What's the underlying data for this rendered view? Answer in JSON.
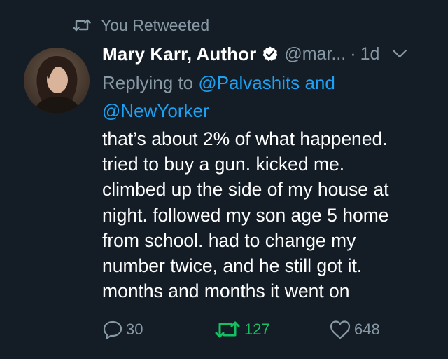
{
  "retweet_context": {
    "label": "You Retweeted",
    "icon": "retweet-icon"
  },
  "author": {
    "name": "Mary Karr, Author",
    "verified_icon": "verified-badge-icon",
    "handle": "@mar...",
    "separator": "·",
    "time": "1d",
    "menu_icon": "chevron-down-icon"
  },
  "reply": {
    "prefix": "Replying to ",
    "mention_1": "@Palvashits",
    "conjunction": " and",
    "mention_2": "@NewYorker"
  },
  "tweet": {
    "lines": [
      "that’s about 2% of what happened.",
      "tried to buy a gun. kicked me.",
      "climbed up the side of my house at",
      "night. followed my son age 5 home",
      "from school. had to change my",
      "number twice, and he still got it.",
      "months and months it went on"
    ]
  },
  "actions": {
    "reply_count": "30",
    "retweet_count": "127",
    "like_count": "648"
  },
  "colors": {
    "background": "#141d26",
    "text": "#ffffff",
    "muted": "#8899a6",
    "link": "#1da1f2",
    "retweet_active": "#17bf63"
  }
}
